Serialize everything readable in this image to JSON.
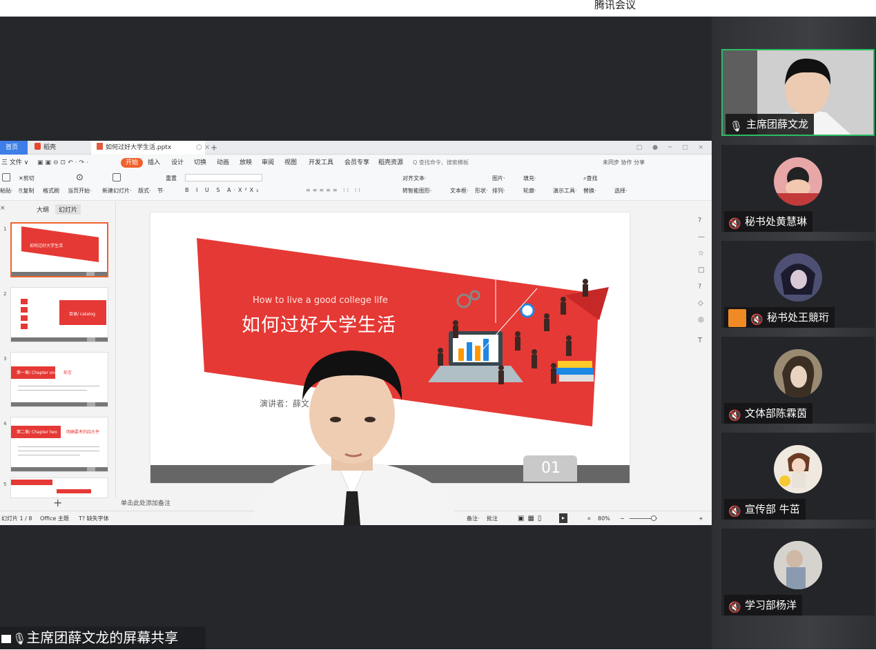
{
  "app": {
    "title": "腾讯会议"
  },
  "share": {
    "label": "主席团薛文龙的屏幕共享",
    "wps": {
      "tabs": {
        "home": "首页",
        "daoke": "稻壳",
        "doc": "如何过好大学生活.pptx"
      },
      "menu": [
        "三 文件 ∨",
        "开始",
        "插入",
        "设计",
        "切换",
        "动画",
        "放映",
        "审阅",
        "视图",
        "开发工具",
        "会员专享",
        "稻壳资源"
      ],
      "search_cmd": "Q 查找命令、搜索模板",
      "collab": "未同步  协作  分享",
      "ribbon": {
        "paste": "粘贴·",
        "cut": "剪切",
        "copy": "复制",
        "format_painter": "格式刷",
        "play_from_current": "当页开始·",
        "new_slide": "新建幻灯片·",
        "layout": "版式·",
        "section": "节·",
        "reset": "重置",
        "textbox": "文本框·",
        "shape": "形状·",
        "arrange": "排列·",
        "picture": "图片·",
        "fill": "填充·",
        "outline": "轮廓·",
        "present_tool": "演示工具·",
        "find": "查找",
        "replace": "替换·",
        "select": "选择·",
        "convert_art": "转智能图形·",
        "align_text": "对齐文本·"
      },
      "pane": {
        "close": "×",
        "outline": "大纲",
        "slides": "幻灯片"
      },
      "thumbs": [
        {
          "num": "1",
          "text": "如何过好大学生活"
        },
        {
          "num": "2",
          "text": "目录/ catalog"
        },
        {
          "num": "3",
          "text": "第一章/ Chapter one"
        },
        {
          "num": "4",
          "text": "第二章/ Chapter two"
        },
        {
          "num": "5",
          "text": ""
        }
      ],
      "thumb_side_labels": {
        "t3": "前言",
        "t4": "明确要考的四大件"
      },
      "add_slide": "+",
      "notes": "单击此处添加备注",
      "slide": {
        "en_title": "How to live a good college life",
        "cn_title": "如何过好大学生活",
        "speaker": "演讲者：薛文",
        "page_no": "01"
      },
      "status": {
        "slide_count": "幻灯片 1 / 8",
        "theme": "Office 主题",
        "missing_font": "T? 缺失字体",
        "notes": "备注·",
        "comments": "批注",
        "zoom": "80%"
      },
      "dock_icons": [
        "?",
        "—",
        "☆",
        "□",
        "?",
        "◇",
        "◎",
        "T"
      ]
    }
  },
  "participants": [
    {
      "name": "主席团薛文龙",
      "mic": "on",
      "active": true
    },
    {
      "name": "秘书处黄慧琳",
      "mic": "muted",
      "active": false
    },
    {
      "name": "秘书处王競珩",
      "mic": "muted",
      "active": false,
      "badge": true
    },
    {
      "name": "文体部陈霖茵",
      "mic": "muted",
      "active": false
    },
    {
      "name": "宣传部 牛茁",
      "mic": "muted",
      "active": false
    },
    {
      "name": "学习部杨洋",
      "mic": "muted",
      "active": false
    }
  ],
  "colors": {
    "accent": "#f0622d",
    "slide_red": "#e53935",
    "active_border": "#2bbd63",
    "bg_dark": "#25272b"
  }
}
